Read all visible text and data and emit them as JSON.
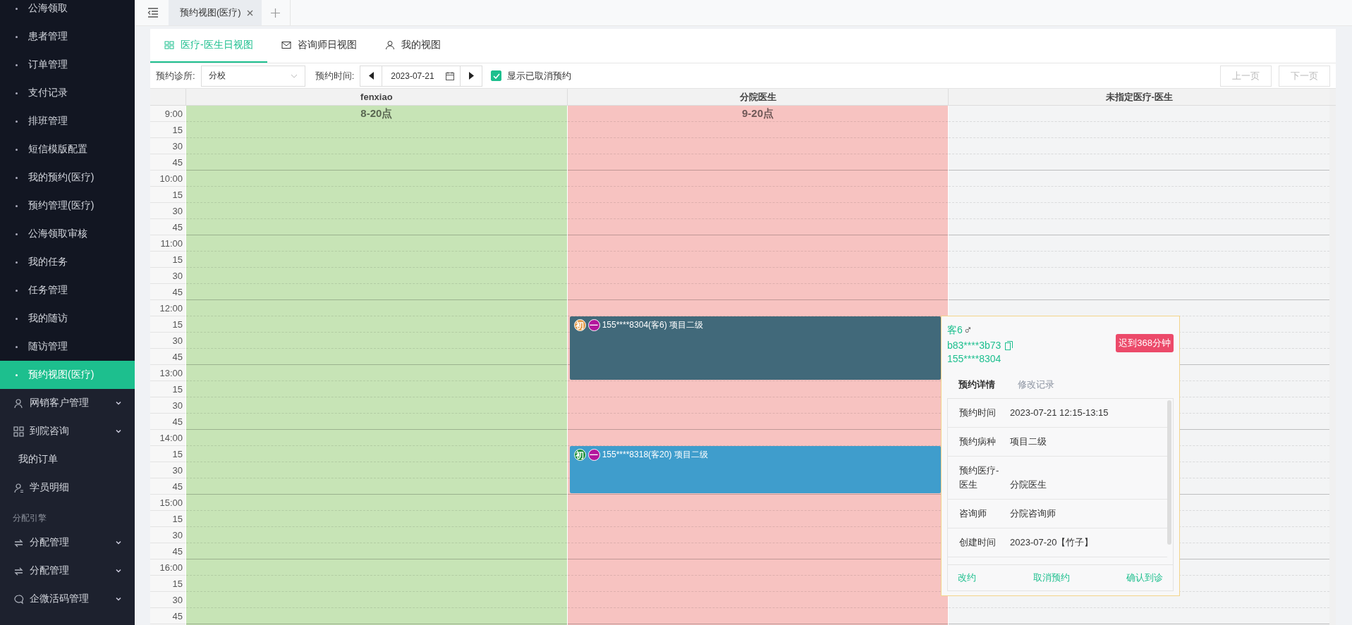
{
  "sidebar": {
    "items": [
      {
        "kind": "sub",
        "label": "公海领取",
        "selected": false
      },
      {
        "kind": "sub",
        "label": "患者管理",
        "selected": false
      },
      {
        "kind": "sub",
        "label": "订单管理",
        "selected": false
      },
      {
        "kind": "sub",
        "label": "支付记录",
        "selected": false
      },
      {
        "kind": "sub",
        "label": "排班管理",
        "selected": false
      },
      {
        "kind": "sub",
        "label": "短信模版配置",
        "selected": false
      },
      {
        "kind": "sub",
        "label": "我的预约(医疗)",
        "selected": false
      },
      {
        "kind": "sub",
        "label": "预约管理(医疗)",
        "selected": false
      },
      {
        "kind": "sub",
        "label": "公海领取审核",
        "selected": false
      },
      {
        "kind": "sub",
        "label": "我的任务",
        "selected": false
      },
      {
        "kind": "sub",
        "label": "任务管理",
        "selected": false
      },
      {
        "kind": "sub",
        "label": "我的随访",
        "selected": false
      },
      {
        "kind": "sub",
        "label": "随访管理",
        "selected": false
      },
      {
        "kind": "sub",
        "label": "预约视图(医疗)",
        "selected": true
      },
      {
        "kind": "menu",
        "label": "网销客户管理",
        "expandable": true,
        "selected": false
      },
      {
        "kind": "menu",
        "label": "到院咨询",
        "expandable": true,
        "selected": false
      },
      {
        "kind": "plain",
        "label": "我的订单",
        "selected": false
      },
      {
        "kind": "menu",
        "label": "学员明细",
        "expandable": false,
        "selected": false
      },
      {
        "kind": "group",
        "label": "分配引擎"
      },
      {
        "kind": "menu",
        "label": "分配管理",
        "expandable": true,
        "selected": false
      },
      {
        "kind": "menu",
        "label": "分配管理",
        "expandable": true,
        "selected": false
      },
      {
        "kind": "menu",
        "label": "企微活码管理",
        "expandable": true,
        "selected": false
      }
    ]
  },
  "page_tabs": [
    {
      "label": "预约视图(医疗)",
      "selected": true
    }
  ],
  "view_tabs": [
    {
      "label": "医疗-医生日视图",
      "selected": true
    },
    {
      "label": "咨询师日视图",
      "selected": false
    },
    {
      "label": "我的视图",
      "selected": false
    }
  ],
  "toolbar": {
    "clinic_label": "预约诊所:",
    "clinic_value": "分校",
    "date_label": "预约时间:",
    "date_value": "2023-07-21",
    "show_cancelled": {
      "label": "显示已取消预约",
      "checked": true
    },
    "pager": [
      {
        "label": "上一页",
        "disabled": true
      },
      {
        "label": "下一页",
        "disabled": true
      }
    ]
  },
  "calendar": {
    "times": [
      "9:00",
      "15",
      "30",
      "45",
      "10:00",
      "15",
      "30",
      "45",
      "11:00",
      "15",
      "30",
      "45",
      "12:00",
      "15",
      "30",
      "45",
      "13:00",
      "15",
      "30",
      "45",
      "14:00",
      "15",
      "30",
      "45",
      "15:00",
      "15",
      "30",
      "45",
      "16:00",
      "15",
      "30",
      "45"
    ],
    "columns": [
      {
        "name": "fenxiao",
        "shift": "8-20点",
        "color": "#c7e4b6"
      },
      {
        "name": "分院医生",
        "shift": "9-20点",
        "color": "#f7c3c1",
        "slots": [
          {
            "booked": false
          },
          {
            "booked": false
          },
          {
            "booked": false
          },
          {
            "booked": false
          },
          {
            "booked": false
          },
          {
            "booked": false
          },
          {
            "booked": false
          },
          {
            "booked": false
          },
          {
            "booked": false
          },
          {
            "booked": false
          },
          {
            "booked": false
          },
          {
            "booked": false
          },
          {
            "booked": false
          },
          {
            "color": "#41697a",
            "badges": [
              {
                "text": "初",
                "color": "#e39a48"
              },
              {
                "text": "一",
                "color": "#b3169c"
              }
            ],
            "label": "155****8304(客6) 项目二级"
          },
          {
            "booked": true
          },
          {
            "booked": true
          },
          {
            "booked": true
          },
          {
            "booked": false
          },
          {
            "booked": false
          },
          {
            "booked": false
          },
          {
            "booked": false
          },
          {
            "color": "#3f9dcc",
            "badges": [
              {
                "text": "初",
                "color": "#1a8f3a"
              },
              {
                "text": "一",
                "color": "#b3169c"
              }
            ],
            "label": "155****8318(客20) 项目二级"
          },
          {
            "booked": true
          },
          {
            "booked": true
          },
          {
            "booked": false
          },
          {
            "booked": false
          },
          {
            "booked": false
          },
          {
            "booked": false
          },
          {
            "booked": false
          },
          {
            "booked": false
          },
          {
            "booked": false
          },
          {
            "booked": false
          }
        ]
      },
      {
        "name": "未指定医疗-医生",
        "color": "#f3f4f5"
      }
    ]
  },
  "popup": {
    "name": "客6",
    "gender": "♂",
    "code": "b83****3b73",
    "phone": "155****8304",
    "late_badge": "迟到368分钟",
    "tabs": [
      {
        "label": "预约详情",
        "selected": true
      },
      {
        "label": "修改记录",
        "selected": false
      }
    ],
    "details": [
      {
        "label": "预约时间",
        "value": "2023-07-21 12:15-13:15"
      },
      {
        "label": "预约病种",
        "value": "项目二级"
      },
      {
        "label": "预约医疗-医生",
        "value": "分院医生"
      },
      {
        "label": "咨询师",
        "value": "分院咨询师"
      },
      {
        "label": "创建时间",
        "value": "2023-07-20【竹子】"
      }
    ],
    "actions": [
      "改约",
      "取消预约",
      "确认到诊"
    ]
  }
}
